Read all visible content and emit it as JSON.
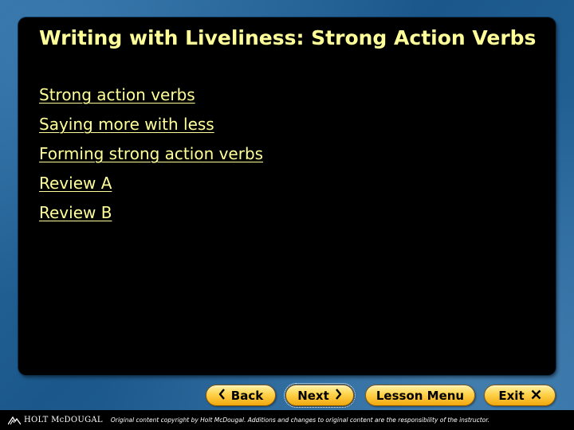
{
  "slide": {
    "title": "Writing with Liveliness: Strong Action Verbs",
    "links": [
      {
        "label": "Strong action verbs"
      },
      {
        "label": "Saying more with less"
      },
      {
        "label": "Forming strong action verbs"
      },
      {
        "label": "Review A"
      },
      {
        "label": "Review B"
      }
    ]
  },
  "nav": {
    "back_label": "Back",
    "back_icon": "chevron-left-icon",
    "next_label": "Next",
    "next_icon": "chevron-right-icon",
    "lesson_menu_label": "Lesson Menu",
    "exit_label": "Exit",
    "exit_icon": "close-icon"
  },
  "footer": {
    "logo_text": "HOLT McDOUGAL",
    "note": "Original content copyright by Holt McDougal.  Additions and changes to original content are the responsibility of the instructor."
  },
  "colors": {
    "background_blue": "#1f5f93",
    "panel": "#000000",
    "title_text": "#ffff99",
    "button_gold": "#ffd24a"
  }
}
